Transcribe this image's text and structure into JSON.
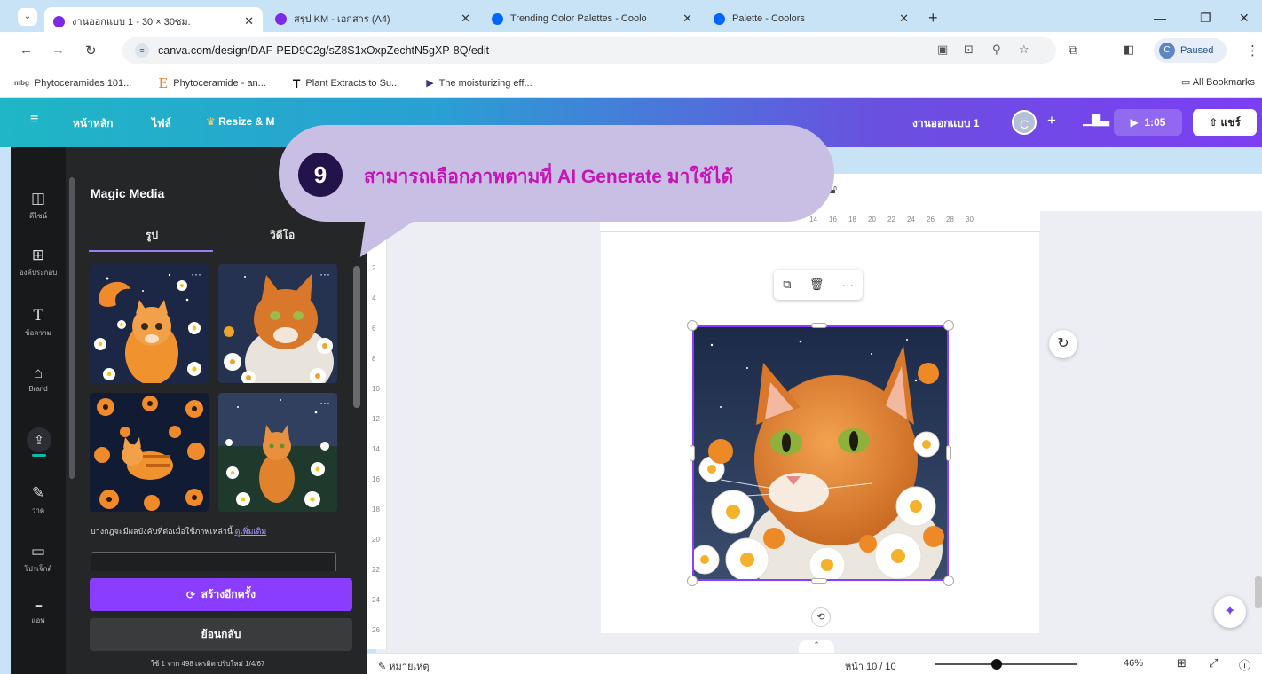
{
  "browser": {
    "tabs": [
      {
        "title": "งานออกแบบ 1 - 30 × 30ซม.",
        "favicon_color": "#7d2ae8",
        "active": true
      },
      {
        "title": "สรุป KM - เอกสาร (A4)",
        "favicon_color": "#7d2ae8",
        "active": false
      },
      {
        "title": "Trending Color Palettes - Coolo",
        "favicon_color": "#0066ff",
        "active": false
      },
      {
        "title": "Palette - Coolors",
        "favicon_color": "#0066ff",
        "active": false
      }
    ],
    "new_tab": "+",
    "url": "canva.com/design/DAF-PED9C2g/sZ8S1xOxpZechtN5gXP-8Q/edit",
    "profile_initial": "C",
    "profile_status": "Paused",
    "bookmarks": [
      {
        "icon": "mbg",
        "label": "Phytoceramides 101..."
      },
      {
        "icon": "E",
        "label": "Phytoceramide - an..."
      },
      {
        "icon": "T",
        "label": "Plant Extracts to Su..."
      },
      {
        "icon": "▶",
        "label": "The moisturizing eff..."
      }
    ],
    "all_bookmarks": "All Bookmarks"
  },
  "canva_header": {
    "home": "หน้าหลัก",
    "file": "ไฟล์",
    "resize": "Resize & M",
    "design_title": "งานออกแบบ 1",
    "avatar_initial": "C",
    "play_time": "1:05",
    "share": "แชร์"
  },
  "rail": [
    {
      "icon": "layout-icon",
      "glyph": "◫",
      "label": "ดีไซน์"
    },
    {
      "icon": "elements-icon",
      "glyph": "⊞",
      "label": "องค์ประกอบ"
    },
    {
      "icon": "text-icon",
      "glyph": "T",
      "label": "ข้อความ"
    },
    {
      "icon": "brand-icon",
      "glyph": "⌂",
      "label": "Brand"
    },
    {
      "icon": "uploads-icon",
      "glyph": "⇪",
      "label": ""
    },
    {
      "icon": "draw-icon",
      "glyph": "✎",
      "label": "วาด"
    },
    {
      "icon": "projects-icon",
      "glyph": "▭",
      "label": "โปรเจ็กต์"
    },
    {
      "icon": "apps-icon",
      "glyph": "⋮⋮⋮",
      "label": "แอพ"
    }
  ],
  "panel": {
    "title": "Magic Media",
    "tabs": [
      "รูป",
      "วิดีโอ"
    ],
    "thumbnail_more": "···",
    "note_text": "บางกฎจะมีผลบังคับที่ต่อเมื่อใช้ภาพเหล่านี้",
    "note_link": "ดูเพิ่มเติม",
    "regenerate": "สร้างอีกครั้ง",
    "back": "ย้อนกลับ",
    "usage": "ใช้ 1 จาก 498 เครดิต ปรับใหม่ 1/4/67"
  },
  "canvas": {
    "ruler_h": [
      "14",
      "16",
      "18",
      "20",
      "22",
      "24",
      "26",
      "28",
      "30"
    ],
    "ruler_v": [
      "2",
      "4",
      "6",
      "8",
      "10",
      "12",
      "14",
      "16",
      "18",
      "20",
      "22",
      "24",
      "26"
    ],
    "more": "···"
  },
  "bottom": {
    "notes": "หมายเหตุ",
    "page": "หน้า 10 / 10",
    "zoom": "46%",
    "zoom_level": 0.43
  },
  "callout": {
    "number": "9",
    "text": "สามารถเลือกภาพตามที่ AI Generate มาใช้ได้",
    "bg_color": "#c9bfe5",
    "text_color": "#c515b6"
  },
  "colors": {
    "canva_purple": "#8b3dff",
    "panel_bg": "#252627",
    "rail_bg": "#18191b"
  }
}
